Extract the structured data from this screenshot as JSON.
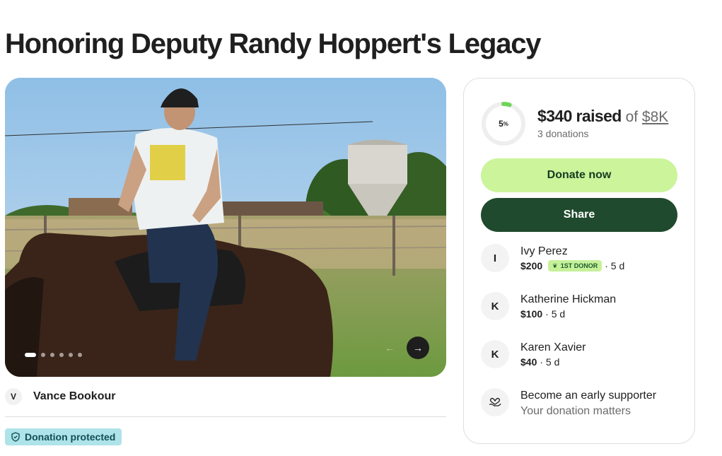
{
  "page": {
    "title": "Honoring Deputy Randy Hoppert's Legacy"
  },
  "hero": {
    "slide_count": 6,
    "active_slide": 1
  },
  "organizer": {
    "initial": "V",
    "name": "Vance Bookour"
  },
  "protection_badge": "Donation protected",
  "progress": {
    "percent_label": "5",
    "percent_symbol": "%",
    "percent_value": 0.05,
    "raised": "$340 raised",
    "of": " of ",
    "goal": "$8K",
    "donations": "3 donations"
  },
  "buttons": {
    "donate": "Donate now",
    "share": "Share"
  },
  "donors": [
    {
      "initial": "I",
      "name": "Ivy Perez",
      "amount": "$200",
      "badge": "1ST DONOR",
      "time": "· 5 d"
    },
    {
      "initial": "K",
      "name": "Katherine Hickman",
      "amount": "$100",
      "time": "· 5 d"
    },
    {
      "initial": "K",
      "name": "Karen Xavier",
      "amount": "$40",
      "time": "· 5 d"
    }
  ],
  "early_supporter": {
    "title": "Become an early supporter",
    "subtitle": "Your donation matters"
  },
  "colors": {
    "donate_button": "#cbf49b",
    "share_button": "#1f4a2d",
    "progress_ring": "#6fd45a",
    "badge": "#aee3ea"
  },
  "icons": [
    "shield-icon",
    "arrow-left-icon",
    "arrow-right-icon",
    "leaf-icon",
    "heart-hand-icon"
  ]
}
